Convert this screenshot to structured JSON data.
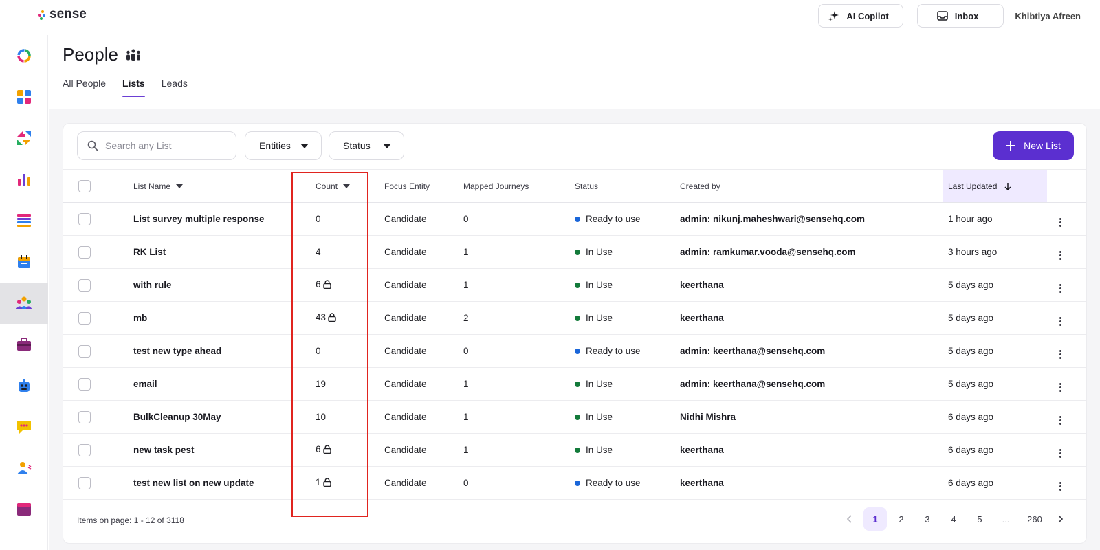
{
  "header": {
    "logo_text": "sense",
    "ai_copilot_label": "AI Copilot",
    "inbox_label": "Inbox",
    "user_name": "Khibtiya Afreen"
  },
  "sidebar": {
    "items": [
      {
        "name": "home",
        "icon": "ring-logo-icon"
      },
      {
        "name": "dashboard",
        "icon": "grid-icon"
      },
      {
        "name": "workflows",
        "icon": "arrows-icon"
      },
      {
        "name": "analytics",
        "icon": "bar-chart-icon"
      },
      {
        "name": "lists",
        "icon": "list-icon"
      },
      {
        "name": "calendar",
        "icon": "calendar-icon"
      },
      {
        "name": "people",
        "icon": "people-icon",
        "active": true
      },
      {
        "name": "jobs",
        "icon": "briefcase-icon"
      },
      {
        "name": "bots",
        "icon": "robot-icon"
      },
      {
        "name": "messages",
        "icon": "chat-icon"
      },
      {
        "name": "contacts",
        "icon": "person-icon"
      },
      {
        "name": "templates",
        "icon": "window-icon"
      }
    ]
  },
  "page": {
    "title": "People",
    "tabs": [
      {
        "label": "All People",
        "active": false
      },
      {
        "label": "Lists",
        "active": true
      },
      {
        "label": "Leads",
        "active": false
      }
    ]
  },
  "filters": {
    "search_placeholder": "Search any List",
    "entities_label": "Entities",
    "status_label": "Status",
    "new_list_label": "New List"
  },
  "table": {
    "columns": {
      "list_name": "List Name",
      "count": "Count",
      "focus_entity": "Focus Entity",
      "mapped_journeys": "Mapped Journeys",
      "status": "Status",
      "created_by": "Created by",
      "last_updated": "Last Updated"
    },
    "rows": [
      {
        "name": "List survey multiple response",
        "count": "0",
        "locked": false,
        "entity": "Candidate",
        "journeys": "0",
        "status": "Ready to use",
        "status_color": "#1a66d9",
        "created_by": "admin: nikunj.maheshwari@sensehq.com",
        "updated": "1 hour ago"
      },
      {
        "name": "RK List",
        "count": "4",
        "locked": false,
        "entity": "Candidate",
        "journeys": "1",
        "status": "In Use",
        "status_color": "#137a3a",
        "created_by": "admin: ramkumar.vooda@sensehq.com",
        "updated": "3 hours ago"
      },
      {
        "name": "with rule",
        "count": "6",
        "locked": true,
        "entity": "Candidate",
        "journeys": "1",
        "status": "In Use",
        "status_color": "#137a3a",
        "created_by": "keerthana",
        "updated": "5 days ago"
      },
      {
        "name": "mb",
        "count": "43",
        "locked": true,
        "entity": "Candidate",
        "journeys": "2",
        "status": "In Use",
        "status_color": "#137a3a",
        "created_by": "keerthana",
        "updated": "5 days ago"
      },
      {
        "name": "test new type ahead",
        "count": "0",
        "locked": false,
        "entity": "Candidate",
        "journeys": "0",
        "status": "Ready to use",
        "status_color": "#1a66d9",
        "created_by": "admin: keerthana@sensehq.com",
        "updated": "5 days ago"
      },
      {
        "name": "email",
        "count": "19",
        "locked": false,
        "entity": "Candidate",
        "journeys": "1",
        "status": "In Use",
        "status_color": "#137a3a",
        "created_by": "admin: keerthana@sensehq.com",
        "updated": "5 days ago"
      },
      {
        "name": "BulkCleanup 30May",
        "count": "10",
        "locked": false,
        "entity": "Candidate",
        "journeys": "1",
        "status": "In Use",
        "status_color": "#137a3a",
        "created_by": "Nidhi Mishra",
        "updated": "6 days ago"
      },
      {
        "name": "new task pest",
        "count": "6",
        "locked": true,
        "entity": "Candidate",
        "journeys": "1",
        "status": "In Use",
        "status_color": "#137a3a",
        "created_by": "keerthana",
        "updated": "6 days ago"
      },
      {
        "name": "test new list on new update",
        "count": "1",
        "locked": true,
        "entity": "Candidate",
        "journeys": "0",
        "status": "Ready to use",
        "status_color": "#1a66d9",
        "created_by": "keerthana",
        "updated": "6 days ago"
      }
    ]
  },
  "pagination": {
    "items_info": "Items on page: 1 - 12 of 3118",
    "pages": [
      "1",
      "2",
      "3",
      "4",
      "5",
      "...",
      "260"
    ],
    "current": "1"
  }
}
